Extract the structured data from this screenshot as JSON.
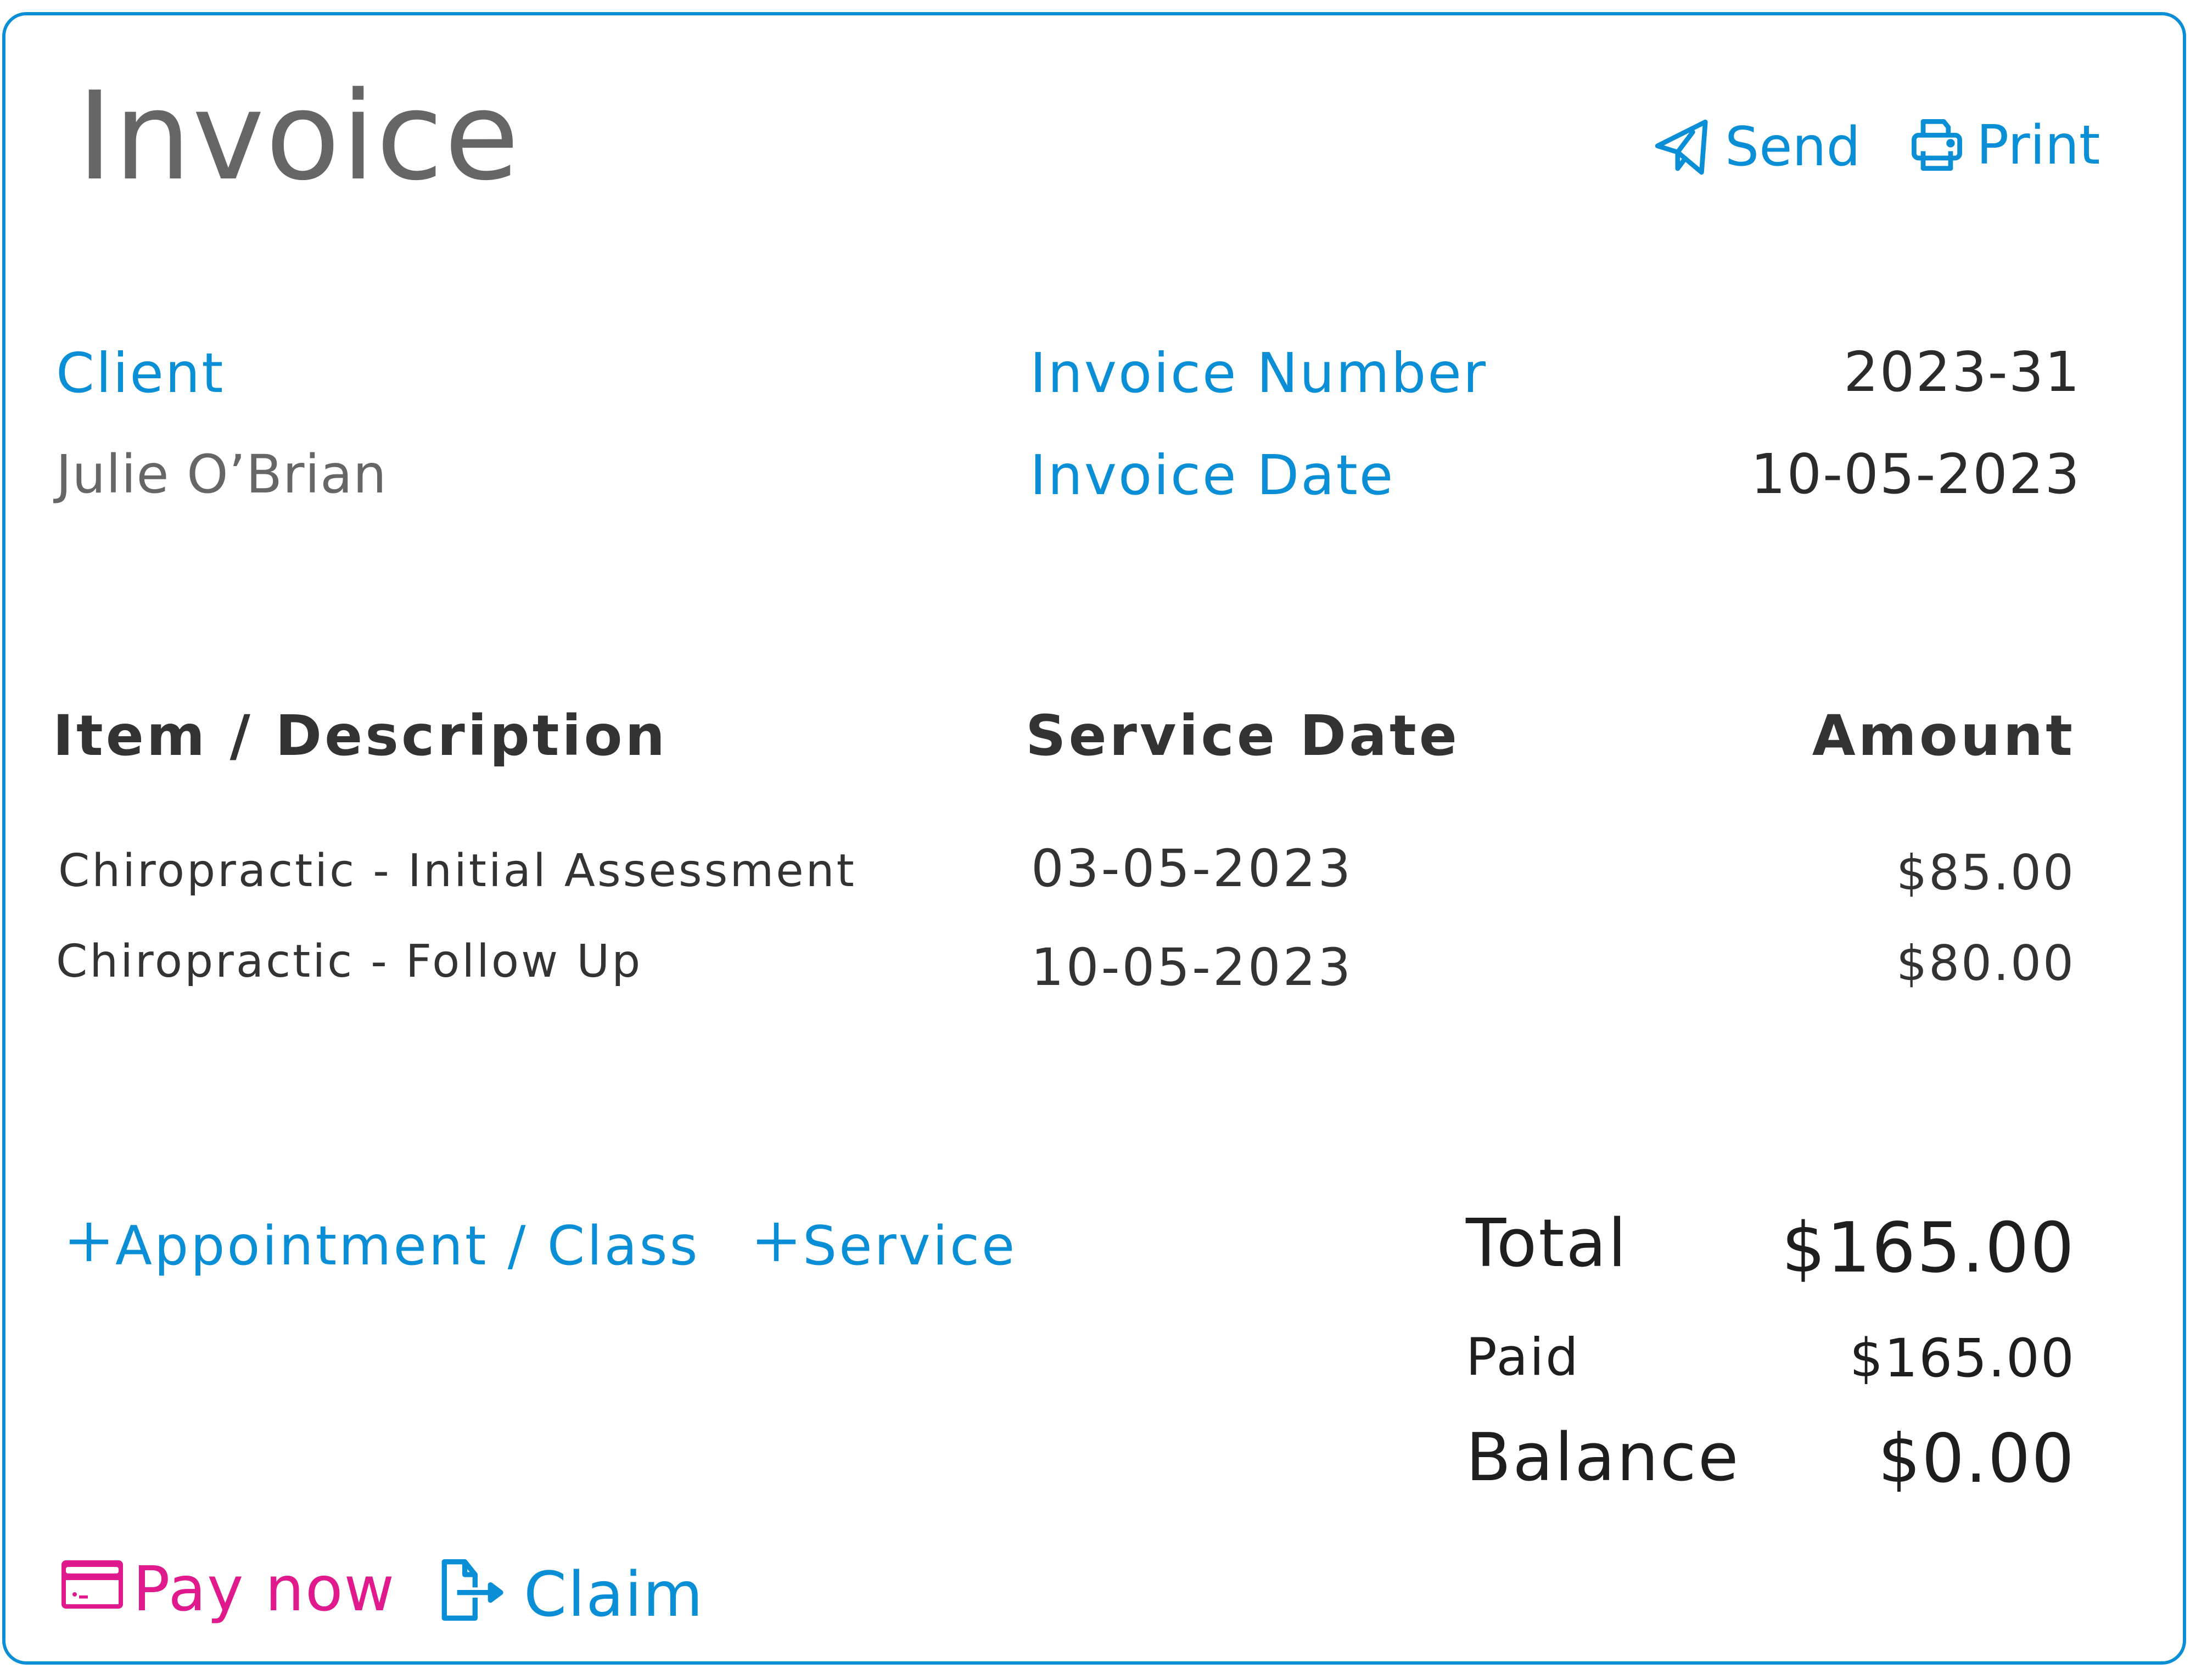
{
  "header": {
    "title": "Invoice",
    "actions": [
      {
        "label": "Send",
        "icon": "paper-plane-icon"
      },
      {
        "label": "Print",
        "icon": "printer-icon"
      }
    ]
  },
  "client": {
    "label": "Client",
    "name": "Julie O’Brian"
  },
  "invoice_meta": {
    "number_label": "Invoice Number",
    "number_value": "2023-31",
    "date_label": "Invoice Date",
    "date_value": "10-05-2023"
  },
  "table": {
    "columns": [
      "Item / Description",
      "Service Date",
      "Amount"
    ],
    "rows": [
      {
        "description": "Chiropractic - Initial Assessment",
        "service_date": "03-05-2023",
        "amount": "$85.00"
      },
      {
        "description": "Chiropractic - Follow Up",
        "service_date": "10-05-2023",
        "amount": "$80.00"
      }
    ]
  },
  "add_buttons": [
    {
      "icon": "plus-icon",
      "label": "Appointment / Class"
    },
    {
      "icon": "plus-icon",
      "label": "Service"
    }
  ],
  "totals": {
    "total_label": "Total",
    "total_value": "$165.00",
    "paid_label": "Paid",
    "paid_value": "$165.00",
    "balance_label": "Balance",
    "balance_value": "$0.00"
  },
  "footer": {
    "pay_now": {
      "label": "Pay now",
      "icon": "credit-card-icon"
    },
    "claim": {
      "label": "Claim",
      "icon": "file-export-icon"
    }
  },
  "colors": {
    "accent": "#0a8fd6",
    "pay": "#e0198c",
    "title": "#666666",
    "text": "#2b2b2b"
  }
}
